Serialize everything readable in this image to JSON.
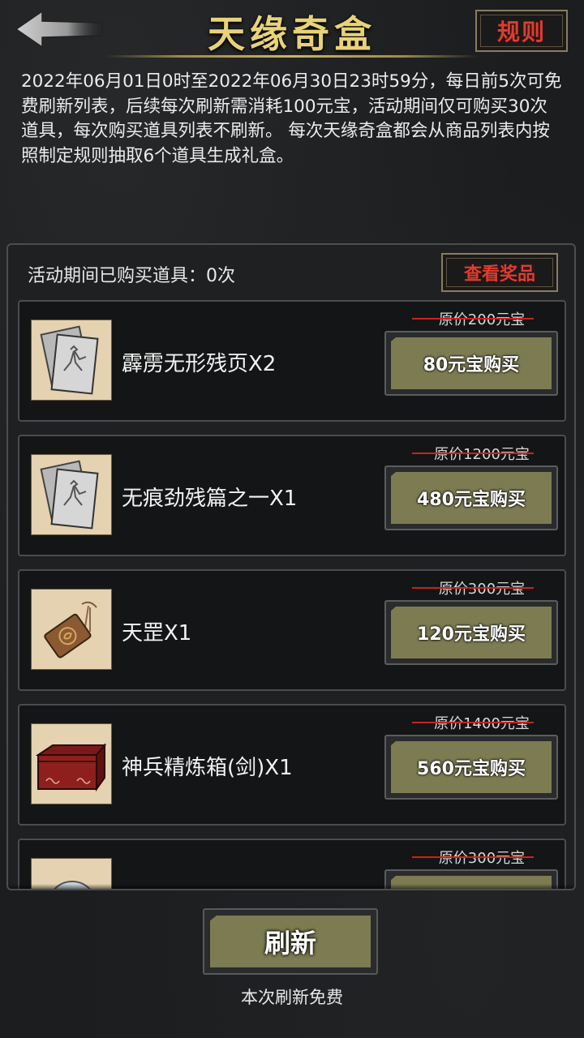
{
  "header": {
    "title": "天缘奇盒",
    "rule_label": "规则",
    "back_icon": "back-arrow-icon"
  },
  "description": "2022年06月01日0时至2022年06月30日23时59分，每日前5次可免费刷新列表，后续每次刷新需消耗100元宝，活动期间仅可购买30次道具，每次购买道具列表不刷新。 每次天缘奇盒都会从商品列表内按照制定规则抽取6个道具生成礼盒。",
  "panel": {
    "purchased_text": "活动期间已购买道具：0次",
    "view_prize_label": "查看奖品"
  },
  "items": [
    {
      "name": "霹雳无形残页X2",
      "orig_price": "原价200元宝",
      "buy_label": "80元宝购买",
      "icon": "scroll-pages-icon"
    },
    {
      "name": "无痕劲残篇之一X1",
      "orig_price": "原价1200元宝",
      "buy_label": "480元宝购买",
      "icon": "scroll-pages-icon"
    },
    {
      "name": "天罡X1",
      "orig_price": "原价300元宝",
      "buy_label": "120元宝购买",
      "icon": "bronze-token-icon"
    },
    {
      "name": "神兵精炼箱(剑)X1",
      "orig_price": "原价1400元宝",
      "buy_label": "560元宝购买",
      "icon": "red-chest-icon"
    },
    {
      "name": "",
      "orig_price": "原价300元宝",
      "buy_label": "",
      "icon": "orb-icon"
    }
  ],
  "footer": {
    "refresh_label": "刷新",
    "refresh_note": "本次刷新免费"
  },
  "colors": {
    "title_gold": "#e8d27a",
    "rule_red": "#e53a2c",
    "button_olive": "#7d7b52",
    "strike_red": "#c8241c"
  }
}
